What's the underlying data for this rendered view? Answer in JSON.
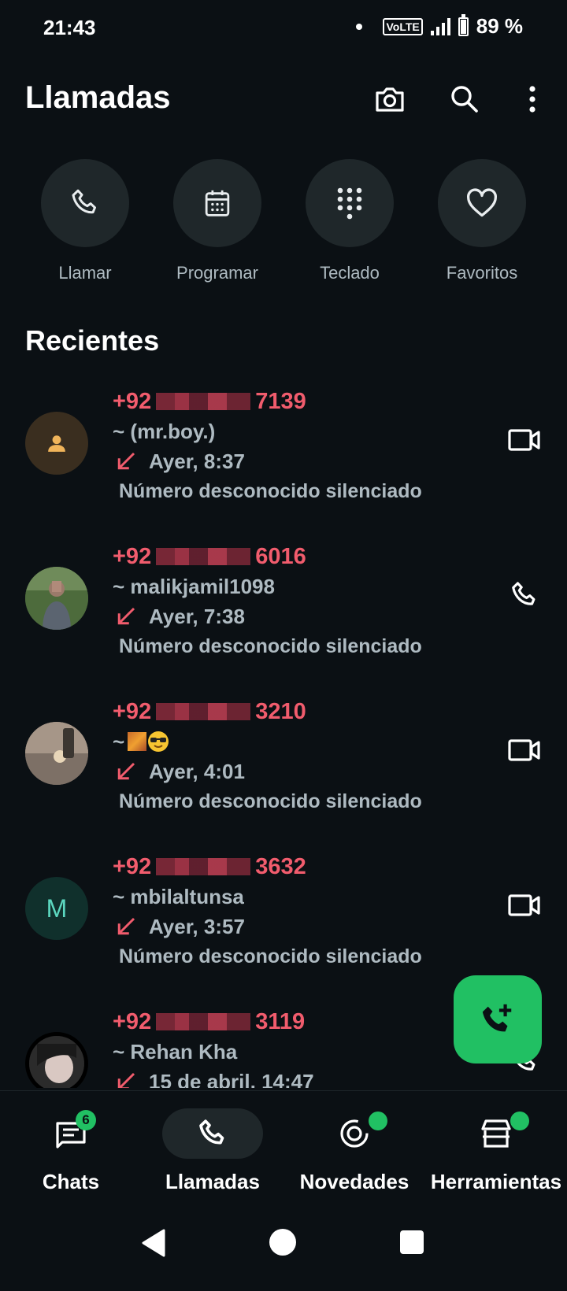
{
  "status_bar": {
    "time": "21:43",
    "network": "VoLTE",
    "battery": "89 %",
    "battery_level": 0.89
  },
  "header": {
    "title": "Llamadas",
    "icons": [
      "camera-icon",
      "search-icon",
      "more-vert-icon"
    ]
  },
  "quick_actions": [
    {
      "label": "Llamar",
      "icon": "phone-icon"
    },
    {
      "label": "Programar",
      "icon": "calendar-icon"
    },
    {
      "label": "Teclado",
      "icon": "dialpad-icon"
    },
    {
      "label": "Favoritos",
      "icon": "heart-icon"
    }
  ],
  "section_title": "Recientes",
  "calls": [
    {
      "prefix": "+92",
      "suffix": "7139",
      "alias": "~ (mr.boy.)",
      "time": "Ayer, 8:37",
      "status": "Número desconocido silenciado",
      "action": "video-call-icon",
      "avatar": "default"
    },
    {
      "prefix": "+92",
      "suffix": "6016",
      "alias": "~ malikjamil1098",
      "time": "Ayer, 7:38",
      "status": "Número desconocido silenciado",
      "action": "voice-call-icon",
      "avatar": "photo"
    },
    {
      "prefix": "+92",
      "suffix": "3210",
      "alias": "~",
      "time": "Ayer, 4:01",
      "status": "Número desconocido silenciado",
      "action": "video-call-icon",
      "avatar": "photo"
    },
    {
      "prefix": "+92",
      "suffix": "3632",
      "alias": "~ mbilaltunsa",
      "time": "Ayer, 3:57",
      "status": "Número desconocido silenciado",
      "action": "video-call-icon",
      "avatar": "M"
    },
    {
      "prefix": "+92",
      "suffix": "3119",
      "alias": "~ Rehan Kha",
      "time": "15 de abril, 14:47",
      "status": "",
      "action": "voice-call-icon",
      "avatar": "photo"
    }
  ],
  "fab": {
    "icon": "add-call-icon"
  },
  "bottom_nav": [
    {
      "label": "Chats",
      "icon": "chats-icon",
      "badge": "6",
      "active": false
    },
    {
      "label": "Llamadas",
      "icon": "phone-icon",
      "badge": "",
      "active": true
    },
    {
      "label": "Novedades",
      "icon": "updates-icon",
      "badge": "dot",
      "active": false
    },
    {
      "label": "Herramientas",
      "icon": "store-icon",
      "badge": "dot",
      "active": false
    }
  ],
  "colors": {
    "background": "#0b1014",
    "accent": "#21c063",
    "missed": "#f15c6d",
    "secondary_text": "#aebac1",
    "surface": "#1f272a"
  }
}
